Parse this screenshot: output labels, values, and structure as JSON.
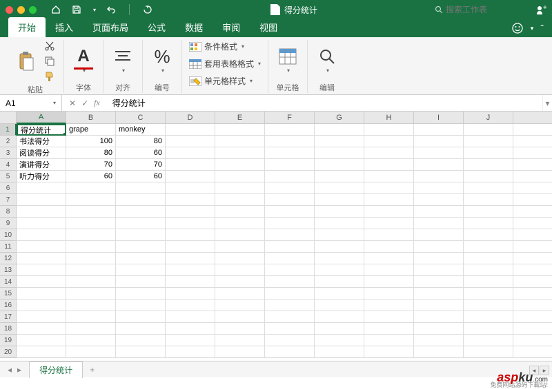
{
  "titlebar": {
    "doc_title": "得分统计",
    "search_placeholder": "搜索工作表"
  },
  "tabs": {
    "items": [
      "开始",
      "插入",
      "页面布局",
      "公式",
      "数据",
      "审阅",
      "视图"
    ],
    "active_index": 0
  },
  "ribbon": {
    "paste_label": "粘贴",
    "font_label": "字体",
    "align_label": "对齐",
    "number_label": "编号",
    "percent_symbol": "%",
    "cond_format": "条件格式",
    "table_format": "套用表格格式",
    "cell_style": "单元格样式",
    "cells_label": "单元格",
    "edit_label": "编辑",
    "font_letter": "A"
  },
  "formula_bar": {
    "cell_ref": "A1",
    "value": "得分统计"
  },
  "grid": {
    "columns": [
      "A",
      "B",
      "C",
      "D",
      "E",
      "F",
      "G",
      "H",
      "I",
      "J"
    ],
    "rows": 20,
    "selected": "A1",
    "data": [
      {
        "r": 1,
        "c": "A",
        "v": "得分统计",
        "t": "text"
      },
      {
        "r": 1,
        "c": "B",
        "v": "grape",
        "t": "text"
      },
      {
        "r": 1,
        "c": "C",
        "v": "monkey",
        "t": "text"
      },
      {
        "r": 2,
        "c": "A",
        "v": "书法得分",
        "t": "text"
      },
      {
        "r": 2,
        "c": "B",
        "v": "100",
        "t": "num"
      },
      {
        "r": 2,
        "c": "C",
        "v": "80",
        "t": "num"
      },
      {
        "r": 3,
        "c": "A",
        "v": "阅读得分",
        "t": "text"
      },
      {
        "r": 3,
        "c": "B",
        "v": "80",
        "t": "num"
      },
      {
        "r": 3,
        "c": "C",
        "v": "60",
        "t": "num"
      },
      {
        "r": 4,
        "c": "A",
        "v": "演讲得分",
        "t": "text"
      },
      {
        "r": 4,
        "c": "B",
        "v": "70",
        "t": "num"
      },
      {
        "r": 4,
        "c": "C",
        "v": "70",
        "t": "num"
      },
      {
        "r": 5,
        "c": "A",
        "v": "听力得分",
        "t": "text"
      },
      {
        "r": 5,
        "c": "B",
        "v": "60",
        "t": "num"
      },
      {
        "r": 5,
        "c": "C",
        "v": "60",
        "t": "num"
      }
    ]
  },
  "sheets": {
    "active": "得分统计"
  },
  "watermark": {
    "brand_a": "asp",
    "brand_b": "ku",
    "tld": ".com",
    "subtitle": "免费网站源码下载站!"
  }
}
